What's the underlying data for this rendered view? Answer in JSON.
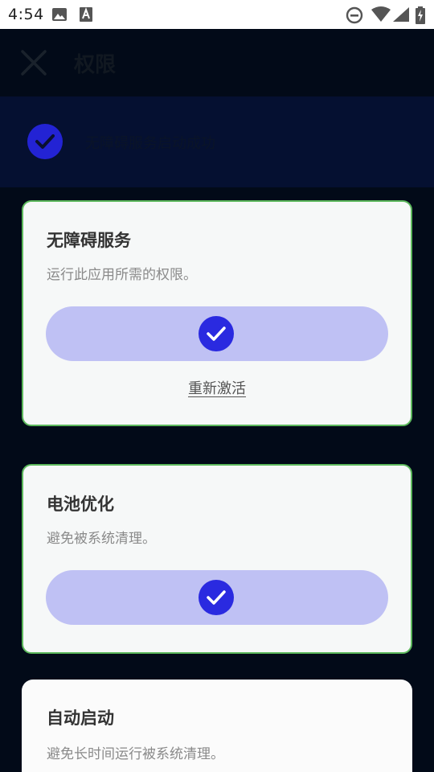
{
  "status_bar": {
    "time": "4:54",
    "icons": [
      "image-icon",
      "a-notification-icon",
      "dnd-icon",
      "wifi-icon",
      "signal-icon",
      "battery-charging-icon"
    ]
  },
  "topbar": {
    "title": "权限"
  },
  "banner": {
    "text": "无障碍服务启动成功"
  },
  "cards": [
    {
      "title": "无障碍服务",
      "desc": "运行此应用所需的权限。",
      "status": "enabled",
      "link": "重新激活"
    },
    {
      "title": "电池优化",
      "desc": "避免被系统清理。",
      "status": "enabled"
    },
    {
      "title": "自动启动",
      "desc": "避免长时间运行被系统清理。"
    }
  ],
  "colors": {
    "accent": "#2a2ae0",
    "pill_bg": "#bfc1f4",
    "card_border": "#5cb85c",
    "overlay_bg": "#020a18",
    "banner_bg": "#051031"
  }
}
